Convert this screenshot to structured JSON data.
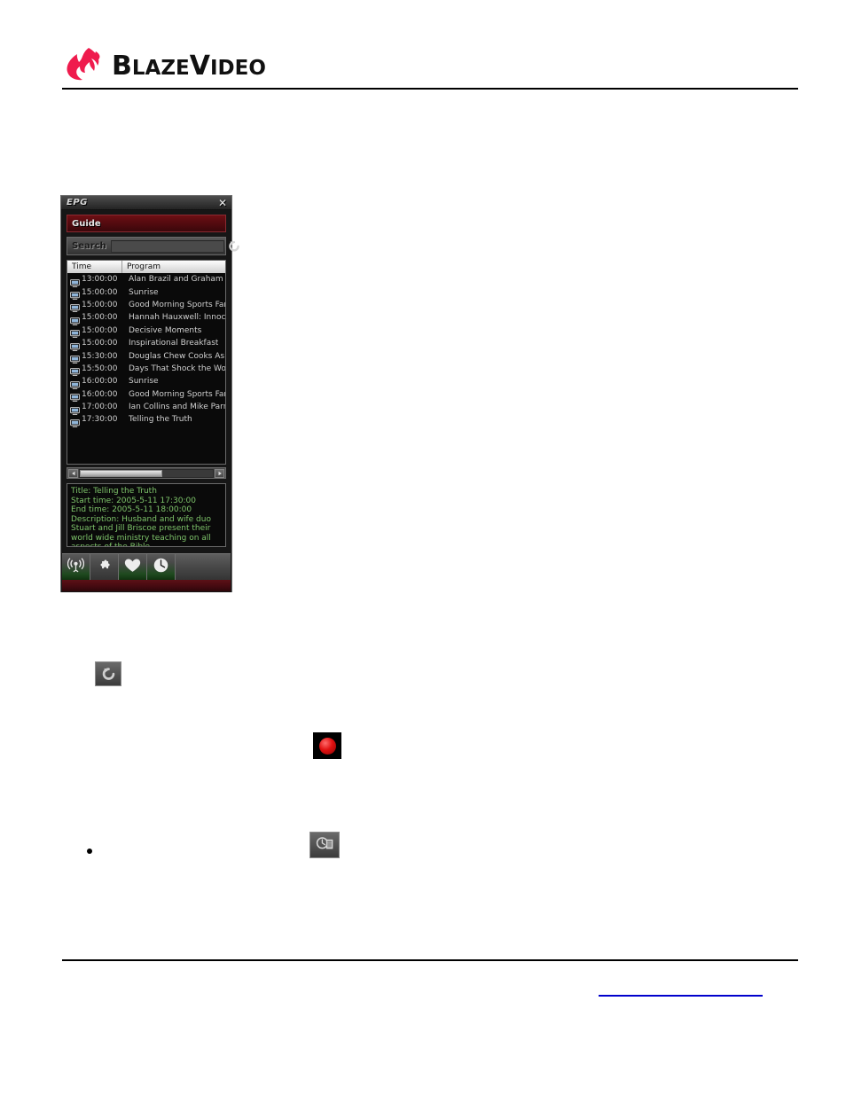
{
  "document": {
    "brand": {
      "name_part1": "B",
      "name_part2": "LAZE",
      "name_part3": "V",
      "name_part4": "IDEO",
      "flame_icon": "flame-icon",
      "flame_color": "#ef1b4d"
    },
    "footer_link_text": ""
  },
  "epg_window": {
    "title": "EPG",
    "close_label": "✕",
    "guide_label": "Guide",
    "search": {
      "label": "Search",
      "value": "",
      "placeholder": "",
      "go_icon": "refresh-icon"
    },
    "columns": {
      "time": "Time",
      "program": "Program"
    },
    "programs": [
      {
        "icon": "tv-icon",
        "time": "13:00:00",
        "program": "Alan Brazil and Graham Bee"
      },
      {
        "icon": "tv-icon",
        "time": "15:00:00",
        "program": "Sunrise"
      },
      {
        "icon": "tv-icon",
        "time": "15:00:00",
        "program": "Good Morning Sports Fans"
      },
      {
        "icon": "tv-icon",
        "time": "15:00:00",
        "program": "Hannah Hauxwell: Innocent"
      },
      {
        "icon": "tv-icon",
        "time": "15:00:00",
        "program": "Decisive Moments"
      },
      {
        "icon": "tv-icon",
        "time": "15:00:00",
        "program": "Inspirational Breakfast"
      },
      {
        "icon": "tv-icon",
        "time": "15:30:00",
        "program": "Douglas Chew Cooks Asia"
      },
      {
        "icon": "tv-icon",
        "time": "15:50:00",
        "program": "Days That Shock the World"
      },
      {
        "icon": "tv-icon",
        "time": "16:00:00",
        "program": "Sunrise"
      },
      {
        "icon": "tv-icon",
        "time": "16:00:00",
        "program": "Good Morning Sports Fans"
      },
      {
        "icon": "tv-icon",
        "time": "17:00:00",
        "program": "Ian Collins and Mike Parry"
      },
      {
        "icon": "tv-icon",
        "time": "17:30:00",
        "program": "Telling the Truth"
      }
    ],
    "scrollbar": {
      "left_arrow": "◀",
      "right_arrow": "▶"
    },
    "details": {
      "title_line": "Title: Telling the Truth",
      "start_line": "Start time: 2005-5-11 17:30:00",
      "end_line": "End time: 2005-5-11 18:00:00",
      "description_line": "Description: Husband and wife duo Stuart and Jill Briscoe present their world wide ministry teaching on all aspects of the Bible.",
      "text_color": "#7ec46a"
    },
    "toolbar": [
      {
        "name": "broadcast-button",
        "icon": "antenna-icon",
        "state": "lit"
      },
      {
        "name": "plugin-button",
        "icon": "puzzle-icon",
        "state": "plain"
      },
      {
        "name": "favorites-button",
        "icon": "heart-icon",
        "state": "lit"
      },
      {
        "name": "schedule-button",
        "icon": "clock-icon",
        "state": "lit"
      }
    ]
  },
  "inline_icons": {
    "refresh": {
      "name": "refresh-icon"
    },
    "record": {
      "name": "record-icon",
      "color": "#e01010"
    },
    "schedule": {
      "name": "schedule-clock-list-icon"
    }
  }
}
